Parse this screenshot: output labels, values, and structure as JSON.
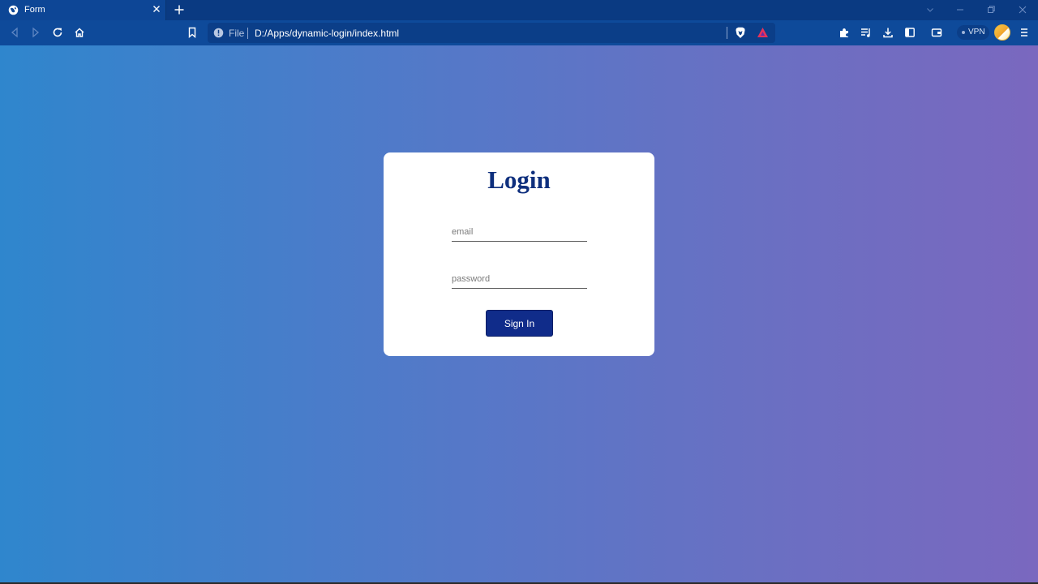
{
  "browser": {
    "tab": {
      "title": "Form"
    },
    "address_bar": {
      "scheme_label": "File",
      "url": "D:/Apps/dynamic-login/index.html"
    },
    "vpn_label": "VPN"
  },
  "page": {
    "card": {
      "title": "Login",
      "email_placeholder": "email",
      "password_placeholder": "password",
      "submit_label": "Sign In"
    }
  },
  "colors": {
    "title": "#0e2f7d",
    "button": "#102c8a",
    "gradient_start": "#2f86cd",
    "gradient_end": "#7a68bf"
  }
}
